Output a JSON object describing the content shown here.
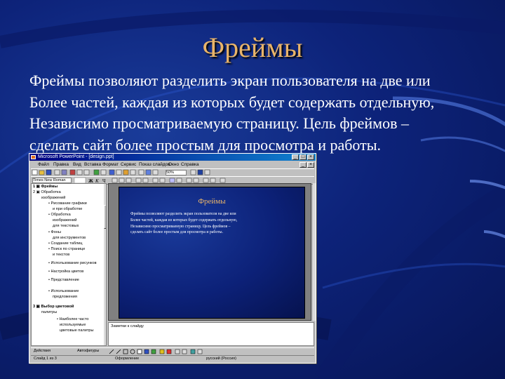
{
  "slide": {
    "title": "Фреймы",
    "body_lines": [
      "Фреймы позволяют разделить экран пользователя на две или",
      "Более частей, каждая из которых будет содержать отдельную,",
      "Независимо просматриваемую страницу. Цель фреймов –",
      "сделать сайт более простым для просмотра и работы."
    ]
  },
  "screenshot": {
    "window_title": "Microsoft PowerPoint - [design.ppt]",
    "menu": [
      "Файл",
      "Правка",
      "Вид",
      "Вставка",
      "Формат",
      "Сервис",
      "Показ слайдов",
      "Окно",
      "Справка"
    ],
    "font_box": "Times New Roman",
    "zoom_box": "50%",
    "outline_items": [
      "1 ▣ Фреймы",
      "2 ▣ Обработка",
      "изображений",
      "• Рисование графики",
      "и при обработке",
      "• Обработка",
      "изображений",
      "для текстовых",
      "• Фоны",
      "для инструментов",
      "• Создание таблиц",
      "• Поиск по странице",
      "и текстов",
      "• Использование рисунков",
      "• Настройка цветов",
      "• Представление",
      "• Использование",
      "предложения",
      "3 ▣ Выбор цветовой",
      "палитры",
      "• Наиболее часто",
      "используемые",
      "цветовые палитры"
    ],
    "slide_title": "Фреймы",
    "slide_lines": [
      "Фреймы позволяют разделить экран пользователя на две или",
      "Более частей, каждая из которых будет содержать отдельную,",
      "Независимо просматриваемую страницу. Цель фреймов –",
      "сделать сайт более простым для просмотра и работы."
    ],
    "notes_text": "Заметки к слайду",
    "draw_label": "Действия",
    "autoshapes_label": "Автофигуры",
    "status": [
      "Слайд 1 из 3",
      "Оформление",
      "русский (Россия)"
    ]
  },
  "colors": {
    "background": "#0d237a",
    "title": "#e8b46a",
    "text": "#ffffff"
  }
}
